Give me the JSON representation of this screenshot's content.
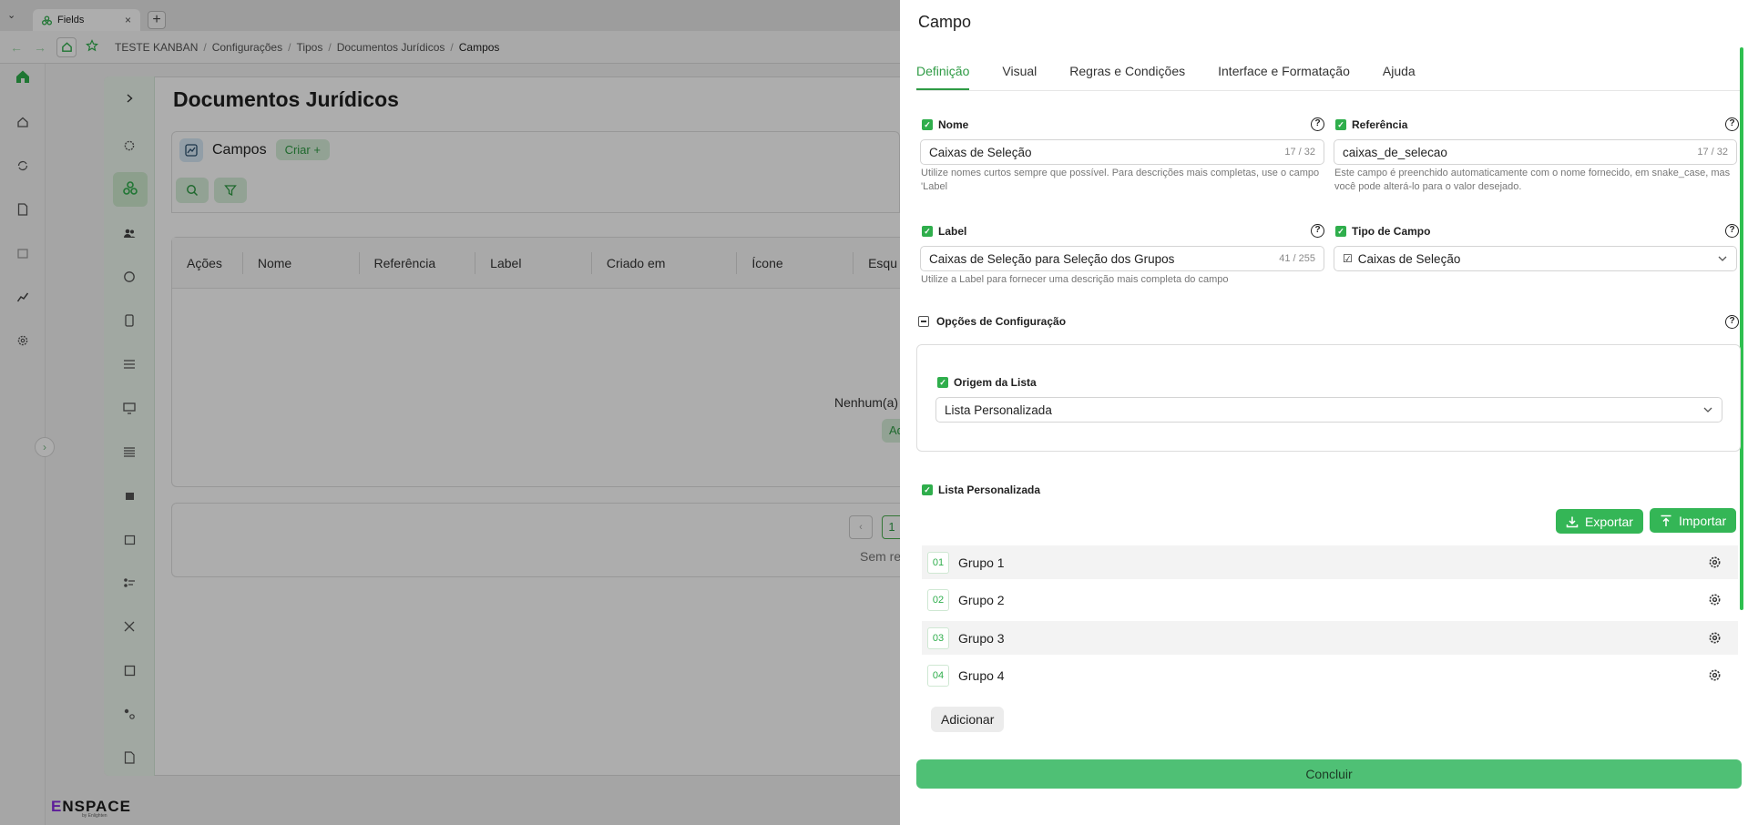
{
  "browser": {
    "tab_title": "Fields",
    "tab_close": "×",
    "new_tab": "+",
    "back": "←",
    "forward": "→",
    "breadcrumbs": [
      "TESTE KANBAN",
      "Configurações",
      "Tipos",
      "Documentos Jurídicos",
      "Campos"
    ],
    "separator": "/"
  },
  "brand": {
    "logo_e": "E",
    "logo_rest": "NSPACE",
    "sub": "by Enlighten"
  },
  "page": {
    "title": "Documentos Jurídicos",
    "section": "Campos",
    "create_label": "Criar +",
    "columns": [
      "Ações",
      "Nome",
      "Referência",
      "Label",
      "Criado em",
      "Ícone",
      "Esqu"
    ],
    "empty_text": "Nenhum(a)",
    "empty_action": "Ad",
    "page_number": "1",
    "pager_prev": "‹",
    "no_results": "Sem re"
  },
  "drawer": {
    "title": "Campo",
    "tabs": [
      "Definição",
      "Visual",
      "Regras e Condições",
      "Interface e Formatação",
      "Ajuda"
    ],
    "help_glyph": "?",
    "check_glyph": "✓",
    "nome": {
      "label": "Nome",
      "value": "Caixas de Seleção",
      "count": "17 / 32",
      "hint": "Utilize nomes curtos sempre que possível. Para descrições mais completas, use o campo 'Label"
    },
    "referencia": {
      "label": "Referência",
      "value": "caixas_de_selecao",
      "count": "17 / 32",
      "hint": "Este campo é preenchido automaticamente com o nome fornecido, em snake_case, mas você pode alterá-lo para o valor desejado."
    },
    "label_field": {
      "label": "Label",
      "value": "Caixas de Seleção para Seleção dos Grupos",
      "count": "41 / 255",
      "hint": "Utilize a Label para fornecer uma descrição mais completa do campo"
    },
    "tipo": {
      "label": "Tipo de Campo",
      "value": "Caixas de Seleção",
      "value_icon": "☑"
    },
    "config": {
      "label": "Opções de Configuração",
      "origem_label": "Origem da Lista",
      "origem_value": "Lista Personalizada"
    },
    "lista": {
      "label": "Lista Personalizada",
      "export_label": "Exportar",
      "import_label": "Importar",
      "items": [
        {
          "num": "01",
          "label": "Grupo 1"
        },
        {
          "num": "02",
          "label": "Grupo 2"
        },
        {
          "num": "03",
          "label": "Grupo 3"
        },
        {
          "num": "04",
          "label": "Grupo 4"
        }
      ],
      "add_label": "Adicionar"
    },
    "submit_label": "Concluir"
  },
  "colors": {
    "accent": "#2fae4c",
    "primary_button": "#4fc075",
    "active_tab": "#2f9b45"
  }
}
